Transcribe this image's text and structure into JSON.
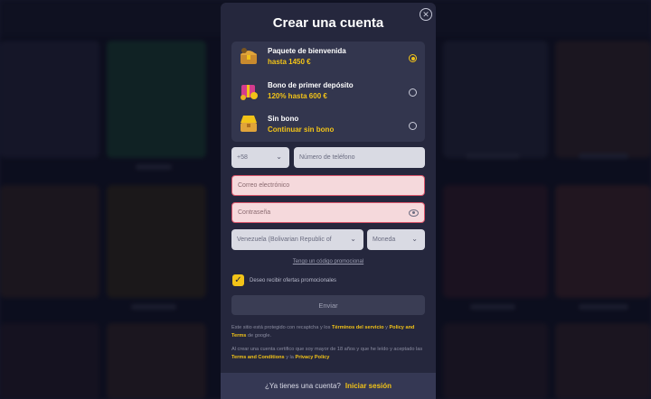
{
  "modal": {
    "title": "Crear una cuenta",
    "bonuses": [
      {
        "title": "Paquete de bienvenida",
        "subtitle": "hasta 1450 €",
        "selected": true,
        "icon": "treasure-chest-icon"
      },
      {
        "title": "Bono de primer depósito",
        "subtitle": "120% hasta 600 €",
        "selected": false,
        "icon": "gift-coins-icon"
      },
      {
        "title": "Sin bono",
        "subtitle": "Continuar sin bono",
        "selected": false,
        "icon": "open-chest-icon"
      }
    ],
    "phone": {
      "code": "+58",
      "placeholder": "Número de teléfono"
    },
    "email": {
      "placeholder": "Correo electrónico"
    },
    "password": {
      "placeholder": "Contraseña"
    },
    "country": {
      "value": "Venezuela (Bolivarian Republic of"
    },
    "currency": {
      "value": "Moneda"
    },
    "promo_link": "Tengo un código promocional",
    "offers_label": "Deseo recibir ofertas promocionales",
    "send_label": "Enviar",
    "legal1": {
      "a": "Este sitio está protegido con recaptcha y los ",
      "b": "Términos del servicio",
      "c": " y ",
      "d": "Policy and Terms",
      "e": " de google."
    },
    "legal2": {
      "a": "Al crear una cuenta certifico que soy mayor de 18 años y que he leído y aceptado las ",
      "b": "Terms and Conditions",
      "c": " y la ",
      "d": "Privacy Policy"
    },
    "footer": {
      "question": "¿Ya tienes una cuenta?",
      "login": "Iniciar sesión"
    }
  },
  "background": {
    "captions": [
      "Top Lobby",
      "Lightning Roulette",
      "XXXtreme Lightning Roulette",
      "Lightning Roulette"
    ]
  },
  "colors": {
    "accent": "#f2c318",
    "modal": "#25273d",
    "error": "#d8546a"
  }
}
